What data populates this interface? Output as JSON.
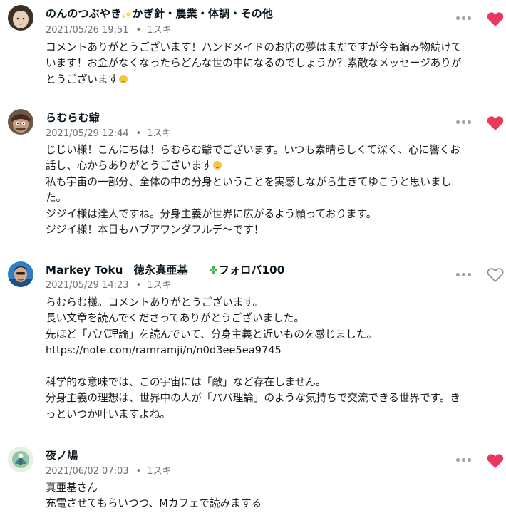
{
  "comments": [
    {
      "name_main": "のんのつぶやき",
      "name_rest": "かぎ針・農業・体調・その他",
      "date": "2021/05/26 19:51",
      "likes": "1スキ",
      "liked": true,
      "lines": [
        "コメントありがとうございます！ハンドメイドのお店の夢はまだですが今も編み物続けて",
        "います！お金がなくなったらどんな世の中になるのでしょうか？素敵なメッセージありが",
        "とうございます"
      ]
    },
    {
      "name": "らむらむ爺",
      "date": "2021/05/29 12:44",
      "likes": "1スキ",
      "liked": true,
      "lines": [
        "じじい様！こんにちは！らむらむ爺でございます。いつも素晴らしくて深く、心に響くお",
        "話し、心からありがとうございます",
        "私も宇宙の一部分、全体の中の分身ということを実感しながら生きてゆこうと思いまし",
        "た。",
        "ジジイ様は達人ですね。分身主義が世界に広がるよう願っております。",
        "ジジイ様！本日もハブアワンダフルデ～です！"
      ]
    },
    {
      "name": "Markey Toku　徳永真亜基",
      "badge": "フォロバ100",
      "date": "2021/05/29 14:23",
      "likes": "1スキ",
      "liked": false,
      "lines": [
        "らむらむ様。コメントありがとうございます。",
        "長い文章を読んでくださってありがとうございました。",
        "先ほど「パパ理論」を読んでいて、分身主義と近いものを感じました。",
        "https://note.com/ramramji/n/n0d3ee5ea9745",
        "",
        "科学的な意味では、この宇宙には「敵」など存在しません。",
        "分身主義の理想は、世界中の人が「パパ理論」のような気持ちで交流できる世界です。き",
        "っといつか叶いますよね。"
      ]
    },
    {
      "name": "夜ノ鳩",
      "date": "2021/06/02 07:03",
      "likes": "1スキ",
      "liked": true,
      "lines": [
        "真亜基さん",
        "充電させてもらいつつ、Mカフェで読みまする"
      ]
    }
  ],
  "icons": {
    "more": "more-horizontal-icon",
    "heart_filled": "heart-filled-icon",
    "heart_outline": "heart-outline-icon"
  },
  "colors": {
    "heart": "#e8385b",
    "heart_outline": "#8d9196",
    "meta": "#6f7072",
    "badge_clover": "#3cb44a"
  }
}
